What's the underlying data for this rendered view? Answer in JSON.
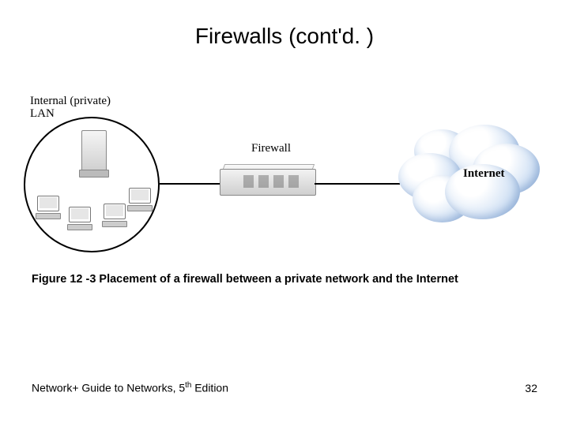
{
  "title": "Firewalls (cont'd. )",
  "diagram": {
    "lan_label_line1": "Internal (private)",
    "lan_label_line2": "LAN",
    "firewall_label": "Firewall",
    "internet_label": "Internet"
  },
  "caption": "Figure 12 -3 Placement of a firewall between a private network and the Internet",
  "footer": {
    "book_prefix": "Network+ Guide to Networks, 5",
    "edition_suffix": "th",
    "edition_word": " Edition",
    "page": "32"
  }
}
